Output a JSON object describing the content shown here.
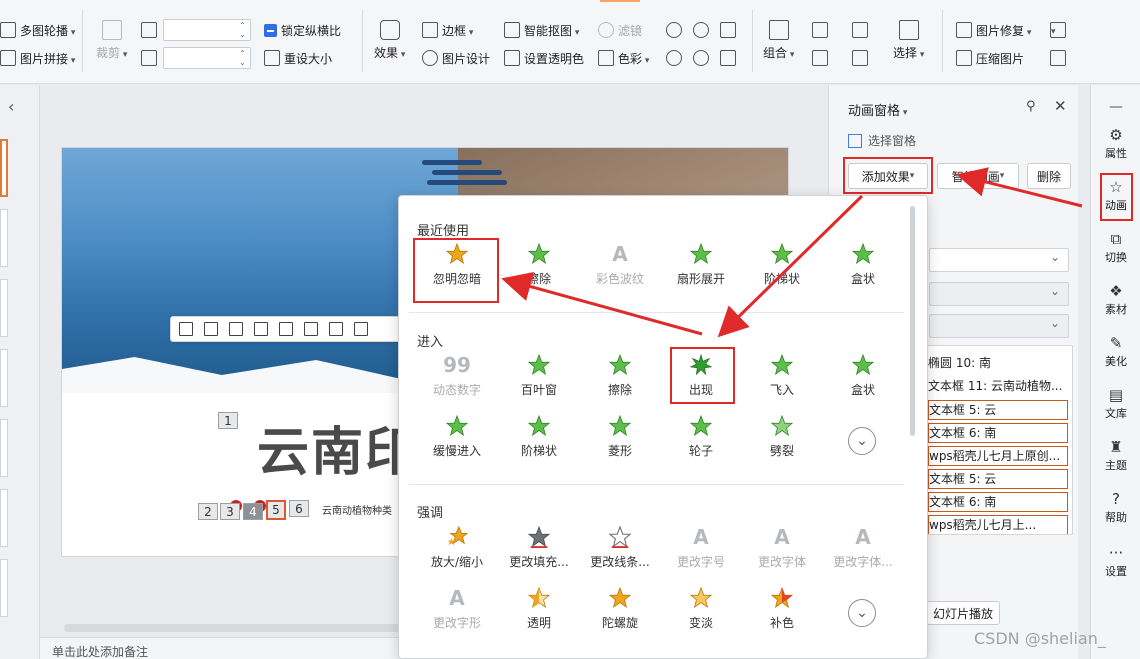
{
  "ribbon": {
    "multi_outline": "多图轮播",
    "picture_collage": "图片拼接",
    "crop": "裁剪",
    "lock_aspect": "锁定纵横比",
    "reset_size": "重设大小",
    "effects": "效果",
    "border": "边框",
    "picture_design": "图片设计",
    "smart_crop": "智能抠图",
    "set_transparent": "设置透明色",
    "filter": "滤镜",
    "color": "色彩",
    "group": "组合",
    "select": "选择",
    "picture_repair": "图片修复",
    "compress_picture": "压缩图片"
  },
  "slide": {
    "title": "云南印",
    "subtitle": "云南动植物种类",
    "seq_top": "1",
    "seq_numbers": [
      "2",
      "3",
      "4",
      "5",
      "6"
    ]
  },
  "notes_placeholder": "单击此处添加备注",
  "anim_pane": {
    "title": "动画窗格",
    "selection_pane": "选择窗格",
    "add_effect": "添加效果",
    "smart_anim": "智能动画",
    "delete": "删除",
    "list": [
      "椭圆 10: 南",
      "文本框 11: 云南动植物...",
      "文本框 5: 云",
      "文本框 6: 南",
      "wps稻壳儿七月上原创...",
      "文本框 5: 云",
      "文本框 6: 南",
      "wps稻壳儿七月上..."
    ],
    "slideshow": "幻灯片播放"
  },
  "side_tabs": [
    "属性",
    "动画",
    "切换",
    "素材",
    "美化",
    "文库",
    "主题",
    "帮助",
    "设置"
  ],
  "gallery": {
    "recent_label": "最近使用",
    "recent": [
      "忽明忽暗",
      "擦除",
      "彩色波纹",
      "扇形展开",
      "阶梯状",
      "盒状"
    ],
    "enter_label": "进入",
    "enter_row1": [
      "动态数字",
      "百叶窗",
      "擦除",
      "出现",
      "飞入",
      "盒状"
    ],
    "enter_row2": [
      "缓慢进入",
      "阶梯状",
      "菱形",
      "轮子",
      "劈裂"
    ],
    "emphasis_label": "强调",
    "emph_row1": [
      "放大/缩小",
      "更改填充...",
      "更改线条...",
      "更改字号",
      "更改字体",
      "更改字体..."
    ],
    "emph_row2": [
      "更改字形",
      "透明",
      "陀螺旋",
      "变淡",
      "补色"
    ]
  },
  "watermark": "CSDN @shelian_",
  "colors": {
    "accent_red": "#e02a2a",
    "star_green": "#3aa83a",
    "star_gold": "#f0a51f"
  }
}
